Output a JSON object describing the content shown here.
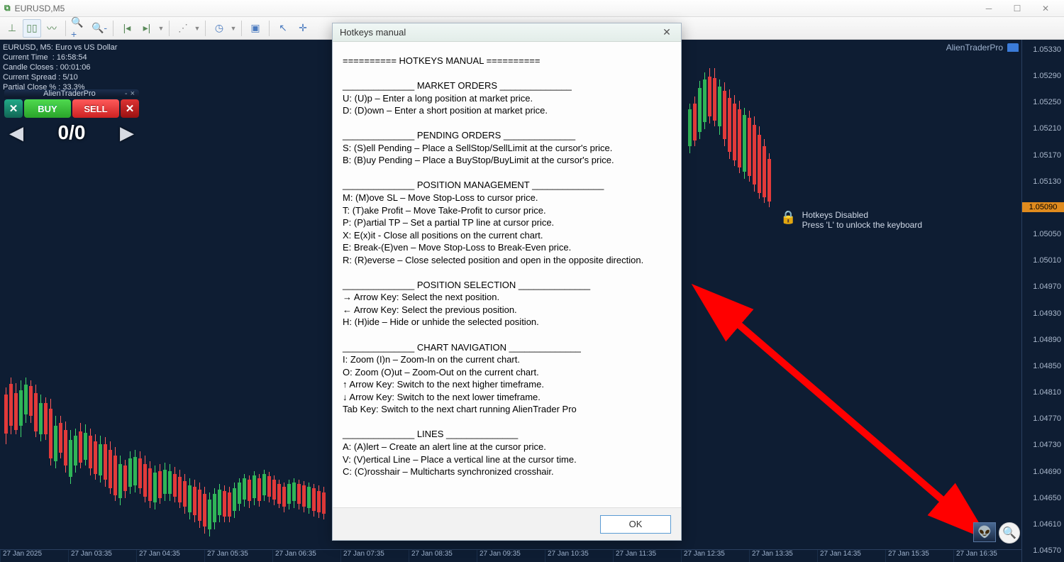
{
  "window": {
    "title": "EURUSD,M5"
  },
  "toolbar_icons": [
    "chart-bars",
    "chart-candles",
    "chart-line",
    "zoom-in",
    "zoom-out",
    "autoscroll-left",
    "autoscroll-right",
    "indent",
    "clock",
    "settings",
    "camera",
    "pointer",
    "crosshair"
  ],
  "info": {
    "symbol_line": "EURUSD, M5:  Euro vs US Dollar",
    "current_time_label": "Current Time",
    "current_time_val": "16:58:54",
    "candle_closes_label": "Candle Closes",
    "candle_closes_val": "00:01:06",
    "spread_label": "Current Spread",
    "spread_val": "5/10",
    "partial_close_label": "Partial Close %",
    "partial_close_val": "33.3%"
  },
  "atp": {
    "title": "AlienTraderPro",
    "buy": "BUY",
    "sell": "SELL",
    "count": "0/0",
    "topright": "AlienTraderPro"
  },
  "hotkeys_box": {
    "line1": "Hotkeys Disabled",
    "line2": "Press 'L' to unlock the keyboard"
  },
  "y_ticks": [
    "1.05330",
    "1.05290",
    "1.05250",
    "1.05210",
    "1.05170",
    "1.05130",
    "1.05090",
    "1.05050",
    "1.05010",
    "1.04970",
    "1.04930",
    "1.04890",
    "1.04850",
    "1.04810",
    "1.04770",
    "1.04730",
    "1.04690",
    "1.04650",
    "1.04610",
    "1.04570"
  ],
  "y_current": "1.05090",
  "x_ticks": [
    "27 Jan 2025",
    "27 Jan 03:35",
    "27 Jan 04:35",
    "27 Jan 05:35",
    "27 Jan 06:35",
    "27 Jan 07:35",
    "27 Jan 08:35",
    "27 Jan 09:35",
    "27 Jan 10:35",
    "27 Jan 11:35",
    "27 Jan 12:35",
    "27 Jan 13:35",
    "27 Jan 14:35",
    "27 Jan 15:35",
    "27 Jan 16:35"
  ],
  "modal": {
    "title": "Hotkeys manual",
    "ok": "OK",
    "lines": [
      "========== HOTKEYS MANUAL ==========",
      "",
      "______________ MARKET ORDERS ______________",
      "U: (U)p – Enter a long position at market price.",
      "D: (D)own – Enter a short position at market price.",
      "",
      "______________ PENDING ORDERS ______________",
      "S: (S)ell Pending – Place a SellStop/SellLimit at the cursor's price.",
      "B: (B)uy Pending – Place a BuyStop/BuyLimit at the cursor's price.",
      "",
      "______________ POSITION MANAGEMENT ______________",
      "M: (M)ove SL – Move Stop-Loss to cursor price.",
      "T: (T)ake Profit – Move Take-Profit to cursor price.",
      "P: (P)artial TP – Set a partial TP line at cursor price.",
      "X: E(x)it - Close all positions on the current chart.",
      "E: Break-(E)ven – Move Stop-Loss to Break-Even price.",
      "R: (R)everse – Close selected position and open in the opposite direction.",
      "",
      "______________ POSITION SELECTION ______________",
      "→ Arrow Key: Select the next position.",
      "← Arrow Key: Select the previous position.",
      "H: (H)ide – Hide or unhide the selected position.",
      "",
      "______________ CHART NAVIGATION ______________",
      "I: Zoom (I)n – Zoom-In on the current chart.",
      "O: Zoom (O)ut – Zoom-Out on the current chart.",
      "↑ Arrow Key: Switch to the next higher timeframe.",
      "↓ Arrow Key: Switch to the next lower timeframe.",
      "Tab Key: Switch to the next chart running AlienTrader Pro",
      "",
      "______________ LINES ______________",
      "A: (A)lert – Create an alert line at the cursor price.",
      "V: (V)ertical Line – Place a vertical line at the cursor time.",
      "C: (C)rosshair – Multicharts synchronized crosshair."
    ]
  },
  "chart_data": {
    "type": "candlestick",
    "symbol": "EURUSD",
    "timeframe": "M5",
    "price_range": [
      1.0457,
      1.0533
    ],
    "current_price": 1.0509,
    "note": "visual approximation of candles shown on screen",
    "left_strip_candles": [
      {
        "x": 6,
        "dir": "down",
        "wt": 490,
        "wb": 570,
        "bt": 500,
        "bb": 555
      },
      {
        "x": 13,
        "dir": "down",
        "wt": 476,
        "wb": 556,
        "bt": 485,
        "bb": 544
      },
      {
        "x": 20,
        "dir": "down",
        "wt": 484,
        "wb": 556,
        "bt": 498,
        "bb": 550
      },
      {
        "x": 27,
        "dir": "up",
        "wt": 480,
        "wb": 560,
        "bt": 494,
        "bb": 544
      },
      {
        "x": 34,
        "dir": "up",
        "wt": 476,
        "wb": 540,
        "bt": 486,
        "bb": 528
      },
      {
        "x": 41,
        "dir": "down",
        "wt": 480,
        "wb": 540,
        "bt": 488,
        "bb": 530
      },
      {
        "x": 48,
        "dir": "down",
        "wt": 486,
        "wb": 560,
        "bt": 498,
        "bb": 552
      },
      {
        "x": 55,
        "dir": "up",
        "wt": 500,
        "wb": 566,
        "bt": 512,
        "bb": 556
      },
      {
        "x": 62,
        "dir": "down",
        "wt": 504,
        "wb": 564,
        "bt": 512,
        "bb": 556
      },
      {
        "x": 69,
        "dir": "down",
        "wt": 506,
        "wb": 600,
        "bt": 520,
        "bb": 590
      },
      {
        "x": 76,
        "dir": "up",
        "wt": 530,
        "wb": 604,
        "bt": 544,
        "bb": 594
      },
      {
        "x": 83,
        "dir": "down",
        "wt": 530,
        "wb": 590,
        "bt": 540,
        "bb": 582
      },
      {
        "x": 90,
        "dir": "down",
        "wt": 538,
        "wb": 610,
        "bt": 550,
        "bb": 600
      },
      {
        "x": 97,
        "dir": "up",
        "wt": 550,
        "wb": 626,
        "bt": 564,
        "bb": 616
      },
      {
        "x": 104,
        "dir": "up",
        "wt": 548,
        "wb": 610,
        "bt": 558,
        "bb": 600
      },
      {
        "x": 111,
        "dir": "down",
        "wt": 540,
        "wb": 604,
        "bt": 552,
        "bb": 596
      },
      {
        "x": 118,
        "dir": "up",
        "wt": 542,
        "wb": 600,
        "bt": 554,
        "bb": 592
      },
      {
        "x": 125,
        "dir": "down",
        "wt": 548,
        "wb": 614,
        "bt": 558,
        "bb": 604
      },
      {
        "x": 132,
        "dir": "down",
        "wt": 556,
        "wb": 620,
        "bt": 566,
        "bb": 612
      },
      {
        "x": 139,
        "dir": "up",
        "wt": 558,
        "wb": 624,
        "bt": 570,
        "bb": 614
      },
      {
        "x": 146,
        "dir": "down",
        "wt": 560,
        "wb": 630,
        "bt": 570,
        "bb": 620
      },
      {
        "x": 153,
        "dir": "down",
        "wt": 566,
        "wb": 640,
        "bt": 578,
        "bb": 632
      },
      {
        "x": 160,
        "dir": "down",
        "wt": 574,
        "wb": 650,
        "bt": 586,
        "bb": 642
      },
      {
        "x": 167,
        "dir": "up",
        "wt": 586,
        "wb": 656,
        "bt": 598,
        "bb": 646
      },
      {
        "x": 174,
        "dir": "down",
        "wt": 592,
        "wb": 646,
        "bt": 600,
        "bb": 636
      },
      {
        "x": 181,
        "dir": "up",
        "wt": 580,
        "wb": 640,
        "bt": 590,
        "bb": 630
      },
      {
        "x": 188,
        "dir": "up",
        "wt": 578,
        "wb": 638,
        "bt": 588,
        "bb": 628
      },
      {
        "x": 195,
        "dir": "down",
        "wt": 580,
        "wb": 640,
        "bt": 590,
        "bb": 632
      },
      {
        "x": 202,
        "dir": "down",
        "wt": 586,
        "wb": 652,
        "bt": 598,
        "bb": 644
      },
      {
        "x": 209,
        "dir": "down",
        "wt": 594,
        "wb": 660,
        "bt": 604,
        "bb": 650
      },
      {
        "x": 216,
        "dir": "up",
        "wt": 600,
        "wb": 662,
        "bt": 610,
        "bb": 652
      },
      {
        "x": 223,
        "dir": "down",
        "wt": 598,
        "wb": 654,
        "bt": 608,
        "bb": 646
      },
      {
        "x": 230,
        "dir": "up",
        "wt": 596,
        "wb": 650,
        "bt": 606,
        "bb": 640
      },
      {
        "x": 237,
        "dir": "up",
        "wt": 598,
        "wb": 650,
        "bt": 608,
        "bb": 640
      },
      {
        "x": 244,
        "dir": "down",
        "wt": 602,
        "wb": 652,
        "bt": 612,
        "bb": 644
      },
      {
        "x": 251,
        "dir": "down",
        "wt": 606,
        "wb": 660,
        "bt": 616,
        "bb": 652
      },
      {
        "x": 258,
        "dir": "down",
        "wt": 612,
        "wb": 668,
        "bt": 622,
        "bb": 658
      },
      {
        "x": 265,
        "dir": "up",
        "wt": 618,
        "wb": 676,
        "bt": 628,
        "bb": 666
      },
      {
        "x": 272,
        "dir": "down",
        "wt": 620,
        "wb": 680,
        "bt": 630,
        "bb": 670
      },
      {
        "x": 279,
        "dir": "down",
        "wt": 624,
        "wb": 688,
        "bt": 634,
        "bb": 678
      },
      {
        "x": 286,
        "dir": "down",
        "wt": 630,
        "wb": 696,
        "bt": 640,
        "bb": 686
      },
      {
        "x": 293,
        "dir": "up",
        "wt": 638,
        "wb": 700,
        "bt": 648,
        "bb": 690
      },
      {
        "x": 300,
        "dir": "up",
        "wt": 632,
        "wb": 690,
        "bt": 640,
        "bb": 680
      },
      {
        "x": 307,
        "dir": "up",
        "wt": 626,
        "wb": 680,
        "bt": 634,
        "bb": 670
      },
      {
        "x": 314,
        "dir": "down",
        "wt": 628,
        "wb": 680,
        "bt": 636,
        "bb": 672
      },
      {
        "x": 321,
        "dir": "down",
        "wt": 630,
        "wb": 680,
        "bt": 638,
        "bb": 672
      },
      {
        "x": 328,
        "dir": "up",
        "wt": 624,
        "wb": 674,
        "bt": 632,
        "bb": 664
      },
      {
        "x": 335,
        "dir": "up",
        "wt": 618,
        "wb": 664,
        "bt": 624,
        "bb": 654
      },
      {
        "x": 342,
        "dir": "up",
        "wt": 612,
        "wb": 658,
        "bt": 618,
        "bb": 648
      },
      {
        "x": 349,
        "dir": "down",
        "wt": 614,
        "wb": 660,
        "bt": 620,
        "bb": 650
      },
      {
        "x": 356,
        "dir": "up",
        "wt": 608,
        "wb": 656,
        "bt": 614,
        "bb": 646
      },
      {
        "x": 363,
        "dir": "down",
        "wt": 612,
        "wb": 658,
        "bt": 618,
        "bb": 650
      },
      {
        "x": 370,
        "dir": "up",
        "wt": 606,
        "wb": 650,
        "bt": 612,
        "bb": 642
      },
      {
        "x": 377,
        "dir": "down",
        "wt": 609,
        "wb": 652,
        "bt": 615,
        "bb": 644
      },
      {
        "x": 384,
        "dir": "down",
        "wt": 614,
        "wb": 656,
        "bt": 620,
        "bb": 648
      },
      {
        "x": 391,
        "dir": "down",
        "wt": 620,
        "wb": 660,
        "bt": 626,
        "bb": 654
      },
      {
        "x": 398,
        "dir": "down",
        "wt": 624,
        "wb": 666,
        "bt": 630,
        "bb": 658
      },
      {
        "x": 405,
        "dir": "up",
        "wt": 620,
        "wb": 662,
        "bt": 626,
        "bb": 654
      },
      {
        "x": 412,
        "dir": "up",
        "wt": 618,
        "wb": 660,
        "bt": 624,
        "bb": 650
      },
      {
        "x": 419,
        "dir": "down",
        "wt": 620,
        "wb": 662,
        "bt": 626,
        "bb": 654
      },
      {
        "x": 426,
        "dir": "down",
        "wt": 622,
        "wb": 666,
        "bt": 628,
        "bb": 658
      },
      {
        "x": 433,
        "dir": "up",
        "wt": 624,
        "wb": 668,
        "bt": 630,
        "bb": 660
      },
      {
        "x": 440,
        "dir": "down",
        "wt": 626,
        "wb": 672,
        "bt": 632,
        "bb": 664
      },
      {
        "x": 447,
        "dir": "down",
        "wt": 628,
        "wb": 674,
        "bt": 636,
        "bb": 666
      },
      {
        "x": 454,
        "dir": "down",
        "wt": 630,
        "wb": 676,
        "bt": 638,
        "bb": 668
      }
    ],
    "right_strip_candles": [
      {
        "x": 970,
        "dir": "up",
        "wt": 90,
        "wb": 160,
        "bt": 98,
        "bb": 150
      },
      {
        "x": 977,
        "dir": "down",
        "wt": 80,
        "wb": 150,
        "bt": 90,
        "bb": 142
      },
      {
        "x": 984,
        "dir": "up",
        "wt": 58,
        "wb": 140,
        "bt": 68,
        "bb": 130
      },
      {
        "x": 991,
        "dir": "up",
        "wt": 46,
        "wb": 126,
        "bt": 56,
        "bb": 116
      },
      {
        "x": 998,
        "dir": "down",
        "wt": 40,
        "wb": 118,
        "bt": 52,
        "bb": 108
      },
      {
        "x": 1005,
        "dir": "down",
        "wt": 40,
        "wb": 122,
        "bt": 54,
        "bb": 114
      },
      {
        "x": 1012,
        "dir": "up",
        "wt": 56,
        "wb": 134,
        "bt": 66,
        "bb": 122
      },
      {
        "x": 1019,
        "dir": "down",
        "wt": 60,
        "wb": 150,
        "bt": 72,
        "bb": 140
      },
      {
        "x": 1026,
        "dir": "down",
        "wt": 70,
        "wb": 168,
        "bt": 82,
        "bb": 158
      },
      {
        "x": 1033,
        "dir": "down",
        "wt": 78,
        "wb": 178,
        "bt": 90,
        "bb": 170
      },
      {
        "x": 1040,
        "dir": "down",
        "wt": 86,
        "wb": 188,
        "bt": 98,
        "bb": 180
      },
      {
        "x": 1047,
        "dir": "up",
        "wt": 96,
        "wb": 196,
        "bt": 106,
        "bb": 186
      },
      {
        "x": 1054,
        "dir": "down",
        "wt": 100,
        "wb": 200,
        "bt": 110,
        "bb": 192
      },
      {
        "x": 1061,
        "dir": "down",
        "wt": 108,
        "wb": 214,
        "bt": 120,
        "bb": 204
      },
      {
        "x": 1068,
        "dir": "down",
        "wt": 122,
        "wb": 224,
        "bt": 134,
        "bb": 216
      },
      {
        "x": 1075,
        "dir": "down",
        "wt": 140,
        "wb": 230,
        "bt": 150,
        "bb": 222
      },
      {
        "x": 1082,
        "dir": "down",
        "wt": 160,
        "wb": 236,
        "bt": 168,
        "bb": 228
      }
    ]
  }
}
